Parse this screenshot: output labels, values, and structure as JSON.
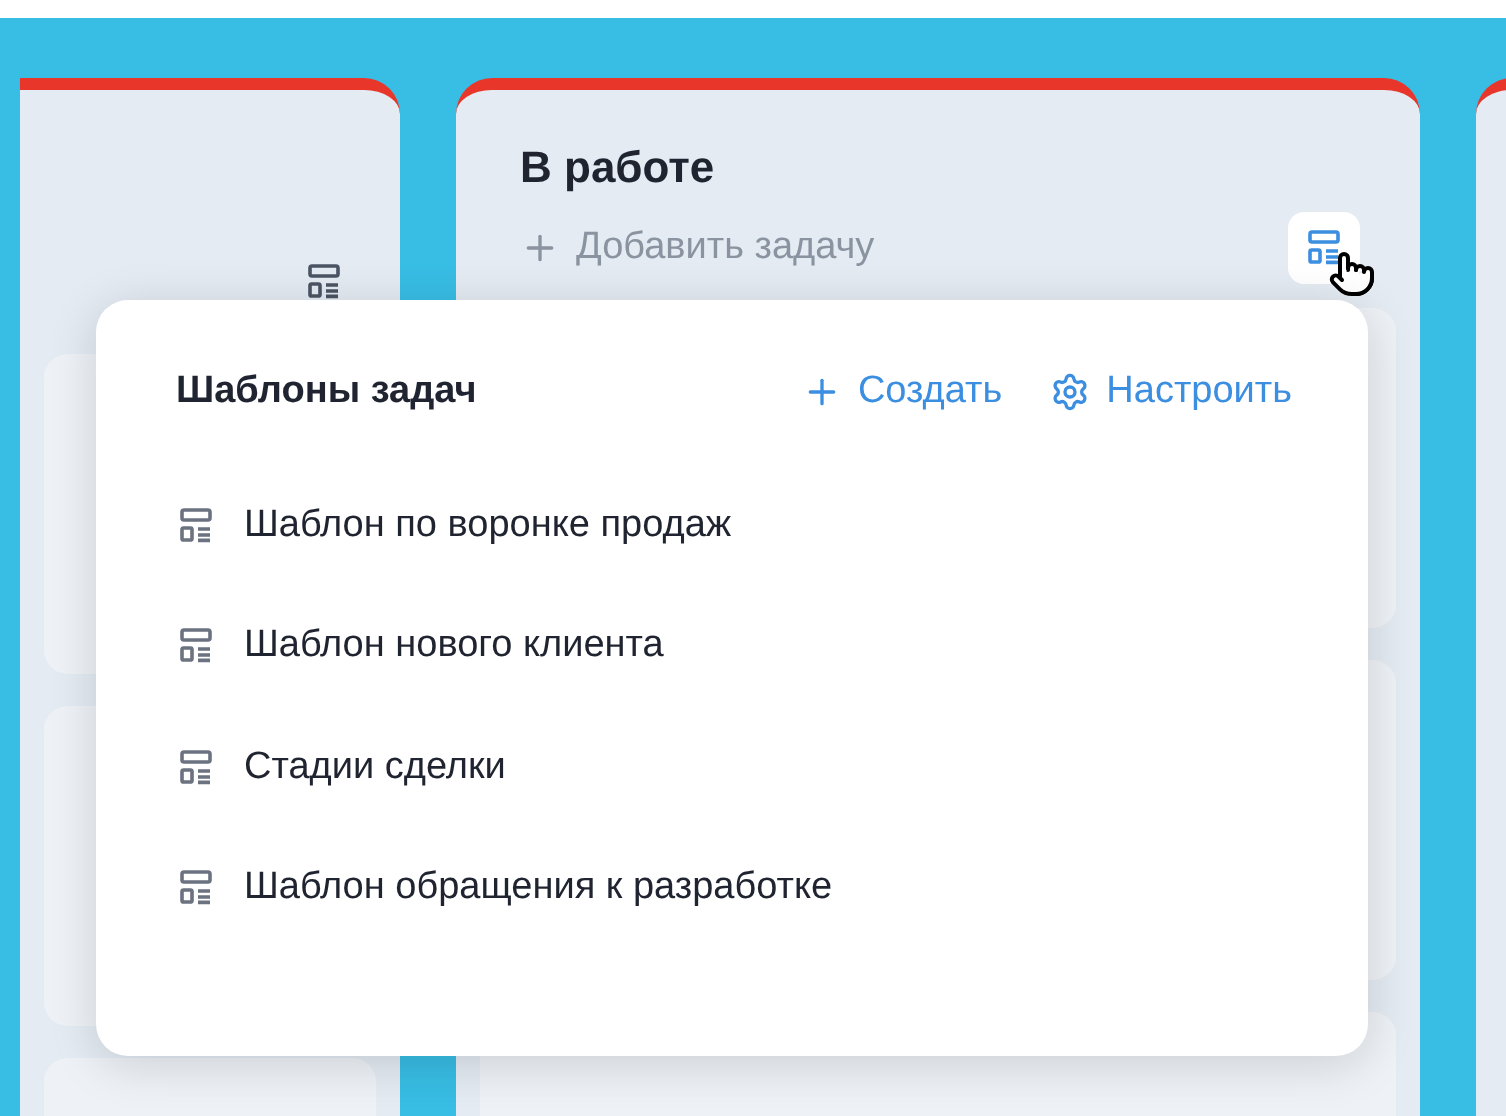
{
  "column": {
    "title": "В работе",
    "add_task": "Добавить задачу"
  },
  "popup": {
    "title": "Шаблоны задач",
    "create": "Создать",
    "settings": "Настроить",
    "templates": [
      {
        "label": "Шаблон по воронке продаж"
      },
      {
        "label": "Шаблон нового клиента"
      },
      {
        "label": "Стадии сделки"
      },
      {
        "label": "Шаблон обращения к разработке"
      }
    ]
  }
}
